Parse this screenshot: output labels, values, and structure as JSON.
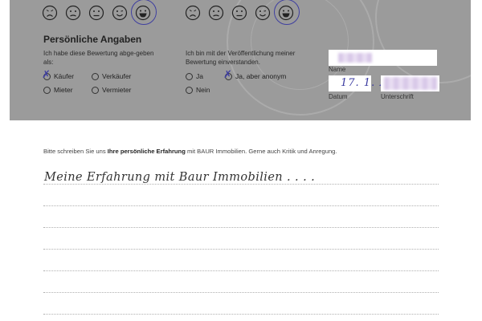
{
  "ratings": {
    "group1": {
      "faces": [
        "very-unhappy-face-icon",
        "unhappy-face-icon",
        "neutral-face-icon",
        "happy-face-icon",
        "very-happy-face-icon"
      ],
      "selected": 4
    },
    "group2": {
      "faces": [
        "very-unhappy-face-icon",
        "unhappy-face-icon",
        "neutral-face-icon",
        "happy-face-icon",
        "very-happy-face-icon"
      ],
      "selected": 4
    }
  },
  "section": {
    "heading": "Persönliche Angaben",
    "role_question": "Ich habe diese Bewertung abge-geben als:",
    "role_options": {
      "kaeufer": "Käufer",
      "verkaeufer": "Verkäufer",
      "mieter": "Mieter",
      "vermieter": "Vermieter"
    },
    "role_selected": "Käufer",
    "consent_question": "Ich bin mit der Veröffentlichung meiner Bewertung einverstanden.",
    "consent_options": {
      "ja": "Ja",
      "anonym": "Ja, aber anonym",
      "nein": "Nein"
    },
    "consent_selected": "Ja, aber anonym"
  },
  "signature_block": {
    "name_label": "Name",
    "date_label": "Datum",
    "date_value": "17. 1. 22",
    "signature_label": "Unterschrift"
  },
  "experience": {
    "intro_prefix": "Bitte schreiben Sie uns ",
    "intro_bold": "Ihre persönliche Erfahrung",
    "intro_suffix": " mit BAUR Immobilien. Gerne auch Kritik und Anregung.",
    "handwritten_text": "Meine Erfahrung mit Baur Immobilien . . . ."
  },
  "colors": {
    "panel": "#9b9b9b",
    "ink": "#3f3fa0"
  }
}
